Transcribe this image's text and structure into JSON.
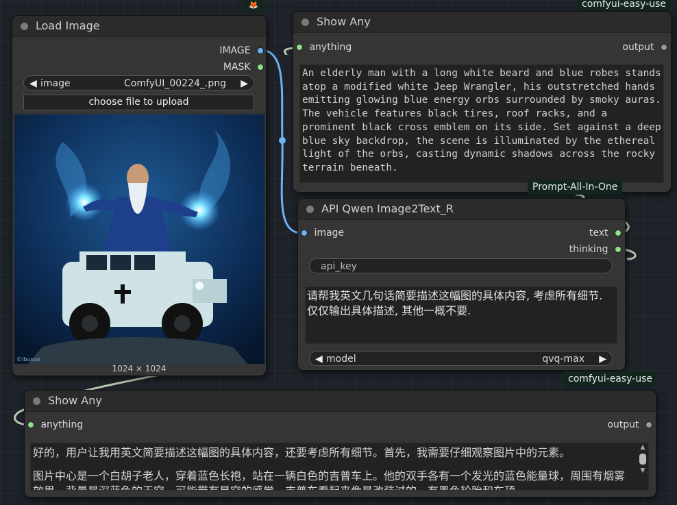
{
  "top_tags": {
    "left": "🦊",
    "right": "comfyui-easy-use"
  },
  "load_image": {
    "title": "Load Image",
    "outputs": [
      "IMAGE",
      "MASK"
    ],
    "image_widget": {
      "label": "image",
      "value": "ComfyUI_00224_.png"
    },
    "upload_button": "choose file to upload",
    "dimensions": "1024 × 1024",
    "watermark": "©lbusoo"
  },
  "show_any_top": {
    "title": "Show Any",
    "input": "anything",
    "output": "output",
    "text": "An elderly man with a long white beard and blue robes stands atop a modified white Jeep Wrangler, his outstretched hands emitting glowing blue energy orbs surrounded by smoky auras. The vehicle features black tires, roof racks, and a prominent black cross emblem on its side. Set against a deep blue sky backdrop, the scene is illuminated by the ethereal light of the orbs, casting dynamic shadows across the rocky terrain beneath."
  },
  "tag_prompt": "Prompt-All-In-One",
  "qwen_node": {
    "title": "API Qwen Image2Text_R",
    "input": "image",
    "outputs": [
      "text",
      "thinking"
    ],
    "api_key_placeholder": "api_key",
    "prompt": "请帮我英文几句话简要描述这幅图的具体内容, 考虑所有细节. 仅仅输出具体描述, 其他一概不要.",
    "model_widget": {
      "label": "model",
      "value": "qvq-max"
    }
  },
  "tag_easy_use": "comfyui-easy-use",
  "show_any_bottom": {
    "title": "Show Any",
    "input": "anything",
    "output": "output",
    "para1": "好的，用户让我用英文简要描述这幅图的具体内容，还要考虑所有细节。首先，我需要仔细观察图片中的元素。",
    "para2": "图片中心是一个白胡子老人，穿着蓝色长袍，站在一辆白色的吉普车上。他的双手各有一个发光的蓝色能量球，周围有烟雾效果。背景是深蓝色的天空，可能带有星空的感觉。吉普车看起来像是改装过的，有黑色轮胎和车顶"
  },
  "colors": {
    "socket_image": "#6fb1f5",
    "socket_any": "#8fe08b",
    "tag_bg": "#13261d"
  }
}
